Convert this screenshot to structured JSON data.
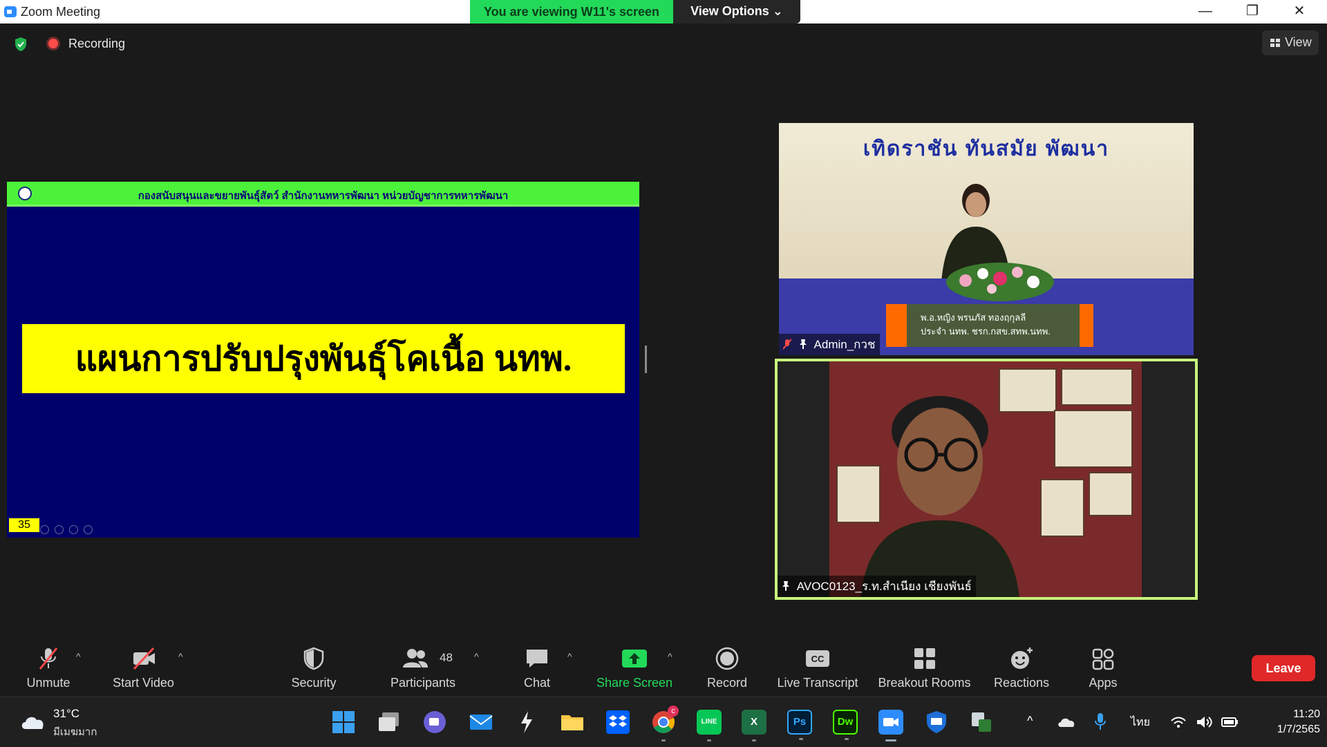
{
  "window": {
    "title": "Zoom Meeting",
    "minimize_glyph": "—",
    "restore_glyph": "❐",
    "close_glyph": "✕"
  },
  "banner": {
    "viewing_text": "You are viewing W11's screen",
    "view_options_label": "View Options ⌄"
  },
  "meeting_bar": {
    "recording_label": "Recording",
    "view_label": "View"
  },
  "slide": {
    "header_text": "กองสนับสนุนและขยายพันธุ์สัตว์ สำนักงานทหารพัฒนา หน่วยบัญชาการทหารพัฒนา",
    "title": "แผนการปรับปรุงพันธุ์โคเนื้อ นทพ.",
    "page_number": "35",
    "colors": {
      "background": "#00006b",
      "header": "#4cf23a",
      "title_bg": "#ffff00"
    }
  },
  "participants_tiles": [
    {
      "name": "Admin_กวช",
      "muted": true,
      "motto": "เทิดราชัน   ทันสมัย   พัฒนา",
      "nameplate_line1": "พ.อ.หญิง พรนภัส  ทองฤกุลลี",
      "nameplate_line2": "ประจำ นทพ. ชรก.กสข.สทพ.นทพ."
    },
    {
      "name": "AVOC0123_ร.ท.สำเนียง เชียงพันธ์",
      "muted": false,
      "active_speaker": true
    }
  ],
  "toolbar": {
    "unmute": "Unmute",
    "start_video": "Start Video",
    "security": "Security",
    "participants": "Participants",
    "participants_count": "48",
    "chat": "Chat",
    "share_screen": "Share Screen",
    "record": "Record",
    "live_transcript": "Live Transcript",
    "breakout_rooms": "Breakout Rooms",
    "reactions": "Reactions",
    "apps": "Apps",
    "leave": "Leave",
    "caret": "^",
    "share_color": "#23d959",
    "leave_color": "#e02828"
  },
  "taskbar": {
    "weather_temp": "31°C",
    "weather_desc": "มีเมฆมาก",
    "apps": [
      {
        "name": "start-icon"
      },
      {
        "name": "task-view-icon"
      },
      {
        "name": "teams-chat-icon"
      },
      {
        "name": "mail-icon"
      },
      {
        "name": "cursor-app-icon"
      },
      {
        "name": "file-explorer-icon"
      },
      {
        "name": "dropbox-icon"
      },
      {
        "name": "chrome-icon"
      },
      {
        "name": "line-icon"
      },
      {
        "name": "excel-icon"
      },
      {
        "name": "photoshop-icon"
      },
      {
        "name": "dreamweaver-icon"
      },
      {
        "name": "zoom-icon"
      },
      {
        "name": "security-shield-icon"
      },
      {
        "name": "network-app-icon"
      }
    ],
    "ps_label": "Ps",
    "dw_label": "Dw",
    "excel_label": "X",
    "line_label": "LINE",
    "chrome_badge": "c",
    "tray_chevron": "^",
    "language": "ไทย",
    "time": "11:20",
    "date": "1/7/2565"
  }
}
